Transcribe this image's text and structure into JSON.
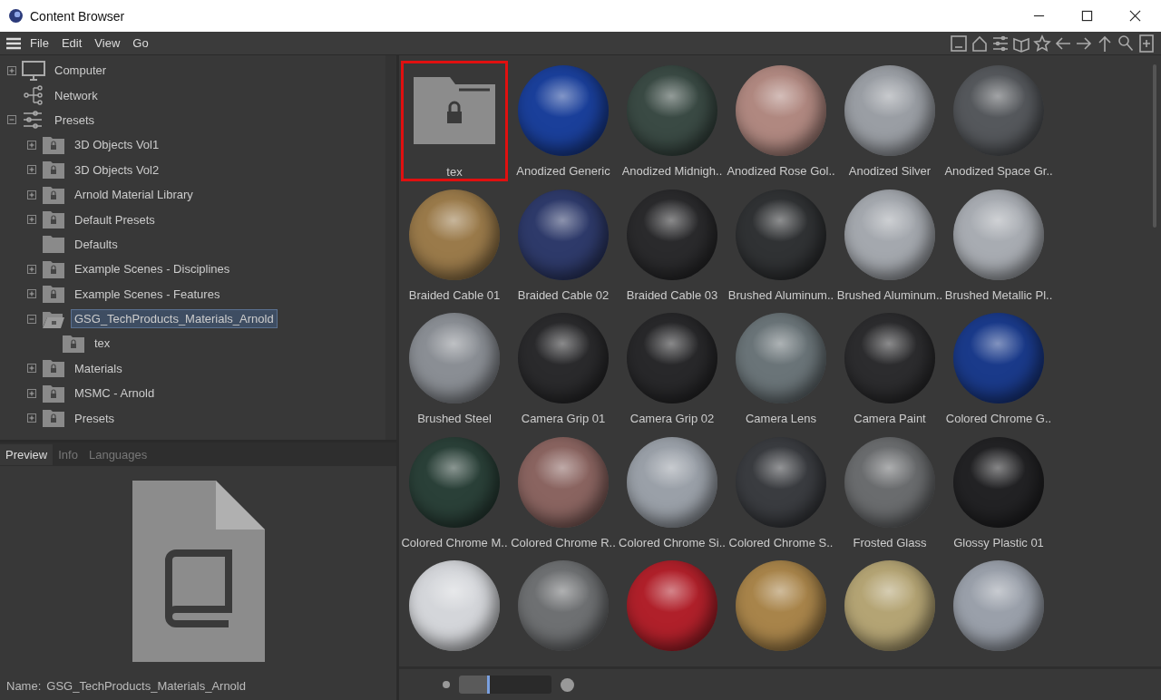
{
  "window": {
    "title": "Content Browser"
  },
  "menu": [
    "File",
    "Edit",
    "View",
    "Go"
  ],
  "tree": [
    {
      "label": "Computer",
      "kind": "computer",
      "expanded": false,
      "selected": false
    },
    {
      "label": "Network",
      "kind": "network",
      "selected": false
    },
    {
      "label": "Presets",
      "kind": "presets",
      "expanded": true,
      "selected": false,
      "children": [
        {
          "label": "3D Objects Vol1",
          "kind": "locked-folder",
          "expanded": false,
          "selected": false
        },
        {
          "label": "3D Objects Vol2",
          "kind": "locked-folder",
          "expanded": false,
          "selected": false
        },
        {
          "label": "Arnold Material Library",
          "kind": "locked-folder",
          "expanded": false,
          "selected": false
        },
        {
          "label": "Default Presets",
          "kind": "locked-folder",
          "expanded": false,
          "selected": false
        },
        {
          "label": "Defaults",
          "kind": "folder",
          "selected": false
        },
        {
          "label": "Example Scenes - Disciplines",
          "kind": "locked-folder",
          "expanded": false,
          "selected": false
        },
        {
          "label": "Example Scenes - Features",
          "kind": "locked-folder",
          "expanded": false,
          "selected": false
        },
        {
          "label": "GSG_TechProducts_Materials_Arnold",
          "kind": "open-folder",
          "expanded": true,
          "selected": true,
          "children": [
            {
              "label": "tex",
              "kind": "locked-folder",
              "selected": false
            }
          ]
        },
        {
          "label": "Materials",
          "kind": "locked-folder",
          "expanded": false,
          "selected": false
        },
        {
          "label": "MSMC - Arnold",
          "kind": "locked-folder",
          "expanded": false,
          "selected": false
        },
        {
          "label": "Presets",
          "kind": "locked-folder",
          "expanded": false,
          "selected": false
        }
      ]
    }
  ],
  "tabs": [
    {
      "label": "Preview",
      "selected": true
    },
    {
      "label": "Info",
      "selected": false
    },
    {
      "label": "Languages",
      "selected": false
    }
  ],
  "preview": {
    "name_label": "Name:",
    "name": "GSG_TechProducts_Materials_Arnold"
  },
  "items": [
    {
      "kind": "folder",
      "label": "tex",
      "selected": true
    },
    {
      "kind": "material",
      "label": "Anodized Generic",
      "color": "#1a3f9a",
      "selected": false
    },
    {
      "kind": "material",
      "label": "Anodized Midnigh..",
      "color": "#3a4a44",
      "selected": false
    },
    {
      "kind": "material",
      "label": "Anodized Rose Gol..",
      "color": "#b08880",
      "selected": false
    },
    {
      "kind": "material",
      "label": "Anodized Silver",
      "color": "#9a9ea4",
      "selected": false
    },
    {
      "kind": "material",
      "label": "Anodized Space Gr..",
      "color": "#55585c",
      "selected": false
    },
    {
      "kind": "material",
      "label": "Braided Cable 01",
      "color": "#9a7a4a",
      "selected": false
    },
    {
      "kind": "material",
      "label": "Braided Cable 02",
      "color": "#2e3a6a",
      "selected": false
    },
    {
      "kind": "material",
      "label": "Braided Cable 03",
      "color": "#2a2a2c",
      "selected": false
    },
    {
      "kind": "material",
      "label": "Brushed Aluminum..",
      "color": "#303234",
      "selected": false
    },
    {
      "kind": "material",
      "label": "Brushed Aluminum..",
      "color": "#a4a8ae",
      "selected": false
    },
    {
      "kind": "material",
      "label": "Brushed Metallic Pl..",
      "color": "#a8acb2",
      "selected": false
    },
    {
      "kind": "material",
      "label": "Brushed Steel",
      "color": "#8a8e94",
      "selected": false
    },
    {
      "kind": "material",
      "label": "Camera Grip 01",
      "color": "#2a2a2c",
      "selected": false
    },
    {
      "kind": "material",
      "label": "Camera Grip 02",
      "color": "#28282a",
      "selected": false
    },
    {
      "kind": "material",
      "label": "Camera Lens",
      "color": "#6a7478",
      "selected": false
    },
    {
      "kind": "material",
      "label": "Camera Paint",
      "color": "#2c2c2e",
      "selected": false
    },
    {
      "kind": "material",
      "label": "Colored Chrome G..",
      "color": "#1a3a8a",
      "selected": false
    },
    {
      "kind": "material",
      "label": "Colored Chrome M..",
      "color": "#2a4038",
      "selected": false
    },
    {
      "kind": "material",
      "label": "Colored Chrome R..",
      "color": "#8a6460",
      "selected": false
    },
    {
      "kind": "material",
      "label": "Colored Chrome Si..",
      "color": "#9aa0a8",
      "selected": false
    },
    {
      "kind": "material",
      "label": "Colored Chrome S..",
      "color": "#3a3c40",
      "selected": false
    },
    {
      "kind": "material",
      "label": "Frosted Glass",
      "color": "#6a6c6e",
      "selected": false
    },
    {
      "kind": "material",
      "label": "Glossy Plastic 01",
      "color": "#222224",
      "selected": false
    },
    {
      "kind": "material",
      "color": "#d4d6da",
      "selected": false
    },
    {
      "kind": "material",
      "color": "#6e7072",
      "selected": false
    },
    {
      "kind": "material",
      "color": "#b0202a",
      "selected": false
    },
    {
      "kind": "material",
      "color": "#a8844a",
      "selected": false
    },
    {
      "kind": "material",
      "color": "#b4a474",
      "selected": false
    },
    {
      "kind": "material",
      "color": "#9aa0aa",
      "selected": false
    }
  ],
  "zoom_slider": {
    "level": 0.33
  }
}
